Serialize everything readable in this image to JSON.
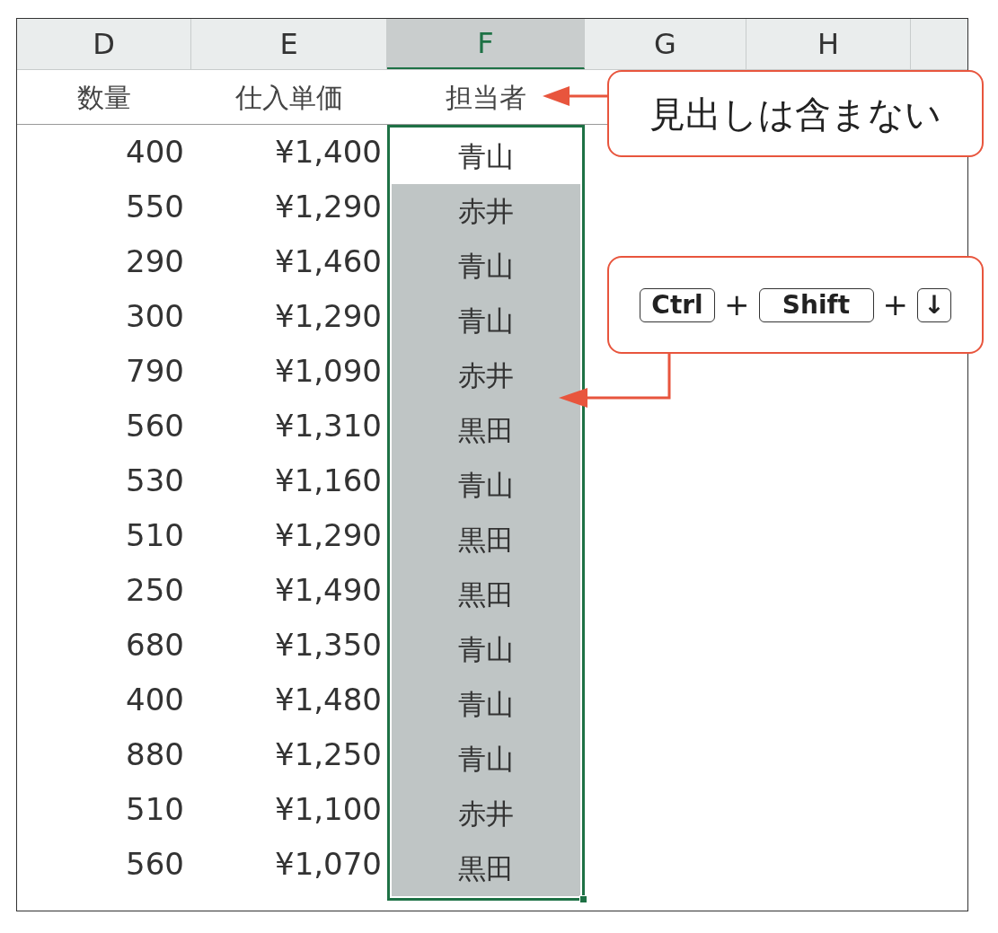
{
  "columns": [
    {
      "label": "D",
      "selected": false
    },
    {
      "label": "E",
      "selected": false
    },
    {
      "label": "F",
      "selected": true
    },
    {
      "label": "G",
      "selected": false
    },
    {
      "label": "H",
      "selected": false
    }
  ],
  "header_row": [
    "数量",
    "仕入単価",
    "担当者"
  ],
  "rows": [
    {
      "quantity": "400",
      "price": "¥1,400",
      "person": "青山",
      "active": true
    },
    {
      "quantity": "550",
      "price": "¥1,290",
      "person": "赤井",
      "active": false
    },
    {
      "quantity": "290",
      "price": "¥1,460",
      "person": "青山",
      "active": false
    },
    {
      "quantity": "300",
      "price": "¥1,290",
      "person": "青山",
      "active": false
    },
    {
      "quantity": "790",
      "price": "¥1,090",
      "person": "赤井",
      "active": false
    },
    {
      "quantity": "560",
      "price": "¥1,310",
      "person": "黒田",
      "active": false
    },
    {
      "quantity": "530",
      "price": "¥1,160",
      "person": "青山",
      "active": false
    },
    {
      "quantity": "510",
      "price": "¥1,290",
      "person": "黒田",
      "active": false
    },
    {
      "quantity": "250",
      "price": "¥1,490",
      "person": "黒田",
      "active": false
    },
    {
      "quantity": "680",
      "price": "¥1,350",
      "person": "青山",
      "active": false
    },
    {
      "quantity": "400",
      "price": "¥1,480",
      "person": "青山",
      "active": false
    },
    {
      "quantity": "880",
      "price": "¥1,250",
      "person": "青山",
      "active": false
    },
    {
      "quantity": "510",
      "price": "¥1,100",
      "person": "赤井",
      "active": false
    },
    {
      "quantity": "560",
      "price": "¥1,070",
      "person": "黒田",
      "active": false
    }
  ],
  "callouts": [
    {
      "kind": "text",
      "text": "見出しは含まない"
    },
    {
      "kind": "keys",
      "parts": [
        {
          "kind": "key",
          "label": "Ctrl"
        },
        {
          "kind": "plus",
          "label": "+"
        },
        {
          "kind": "key",
          "label": "Shift"
        },
        {
          "kind": "plus",
          "label": "+"
        },
        {
          "kind": "key",
          "label": "↓"
        }
      ]
    }
  ]
}
